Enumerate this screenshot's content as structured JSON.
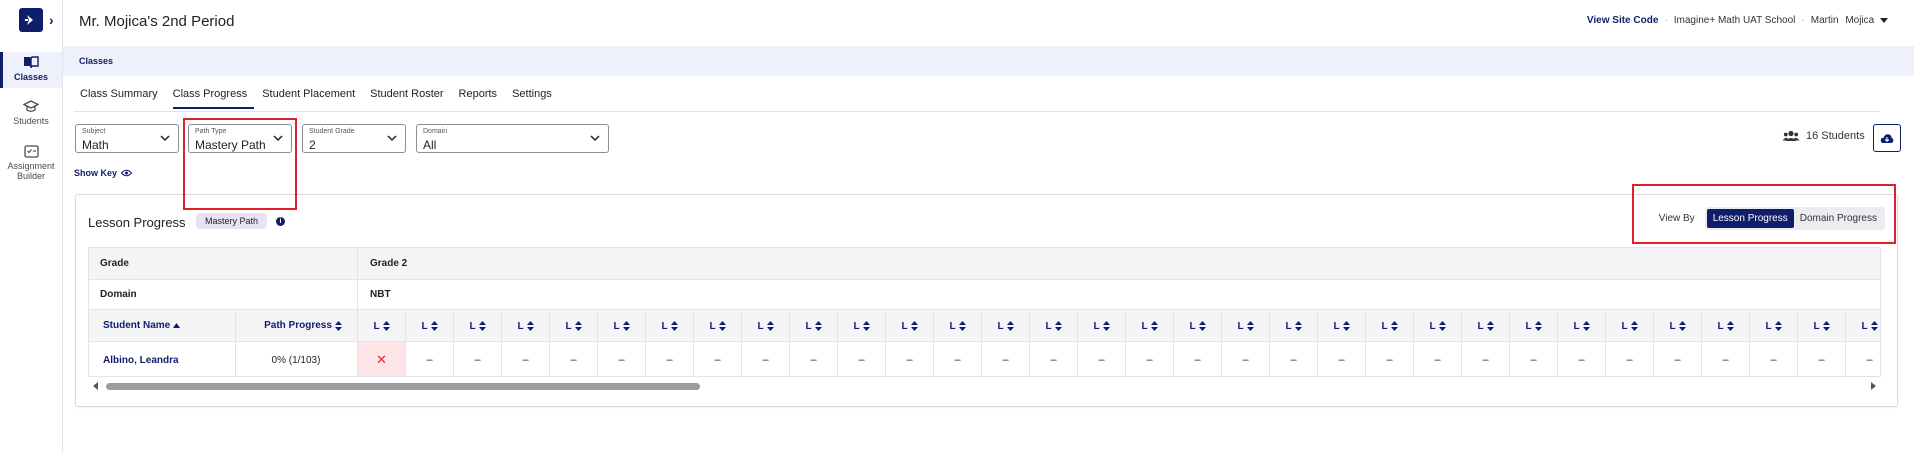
{
  "sidebar": {
    "items": [
      {
        "label": "Classes",
        "icon": "book-icon",
        "active": true
      },
      {
        "label": "Students",
        "icon": "graduation-cap-icon",
        "active": false
      },
      {
        "label": "Assignment Builder",
        "icon": "checklist-icon",
        "active": false
      }
    ]
  },
  "header": {
    "title": "Mr. Mojica's 2nd Period",
    "view_site_code": "View Site Code",
    "school": "Imagine+ Math UAT School",
    "user_first": "Martin",
    "user_last": "Mojica",
    "separator": "·"
  },
  "breadcrumb": {
    "label": "Classes"
  },
  "tabs": [
    {
      "label": "Class Summary",
      "active": false
    },
    {
      "label": "Class Progress",
      "active": true
    },
    {
      "label": "Student Placement",
      "active": false
    },
    {
      "label": "Student Roster",
      "active": false
    },
    {
      "label": "Reports",
      "active": false
    },
    {
      "label": "Settings",
      "active": false
    }
  ],
  "filters": {
    "subject": {
      "label": "Subject",
      "value": "Math"
    },
    "path_type": {
      "label": "Path Type",
      "value": "Mastery Path"
    },
    "student_grade": {
      "label": "Student Grade",
      "value": "2"
    },
    "domain": {
      "label": "Domain",
      "value": "All"
    }
  },
  "students_count": "16 Students",
  "show_key": "Show Key",
  "card": {
    "title": "Lesson Progress",
    "badge": "Mastery Path",
    "info": "i",
    "view_by_label": "View By",
    "view_by_options": [
      "Lesson Progress",
      "Domain Progress"
    ],
    "view_by_selected": "Lesson Progress"
  },
  "table": {
    "grade_label": "Grade",
    "grade_value": "Grade 2",
    "domain_label": "Domain",
    "domain_value": "NBT",
    "col_student": "Student Name",
    "col_progress": "Path Progress",
    "lesson_header": "L",
    "rows": [
      {
        "student": "Albino, Leandra",
        "progress": "0% (1/103)",
        "lessons": [
          "✕",
          "–",
          "–",
          "–",
          "–",
          "–",
          "–",
          "–",
          "–",
          "–",
          "–",
          "–",
          "–",
          "–",
          "–",
          "–",
          "–",
          "–",
          "–",
          "–",
          "–",
          "–",
          "–",
          "–",
          "–",
          "–",
          "–",
          "–",
          "–",
          "–",
          "–",
          "–"
        ]
      }
    ]
  },
  "colors": {
    "navy": "#101d6b",
    "highlight_red": "#e0202b",
    "fail_bg": "#fde4e6",
    "badge_bg": "#e9e1f4"
  }
}
